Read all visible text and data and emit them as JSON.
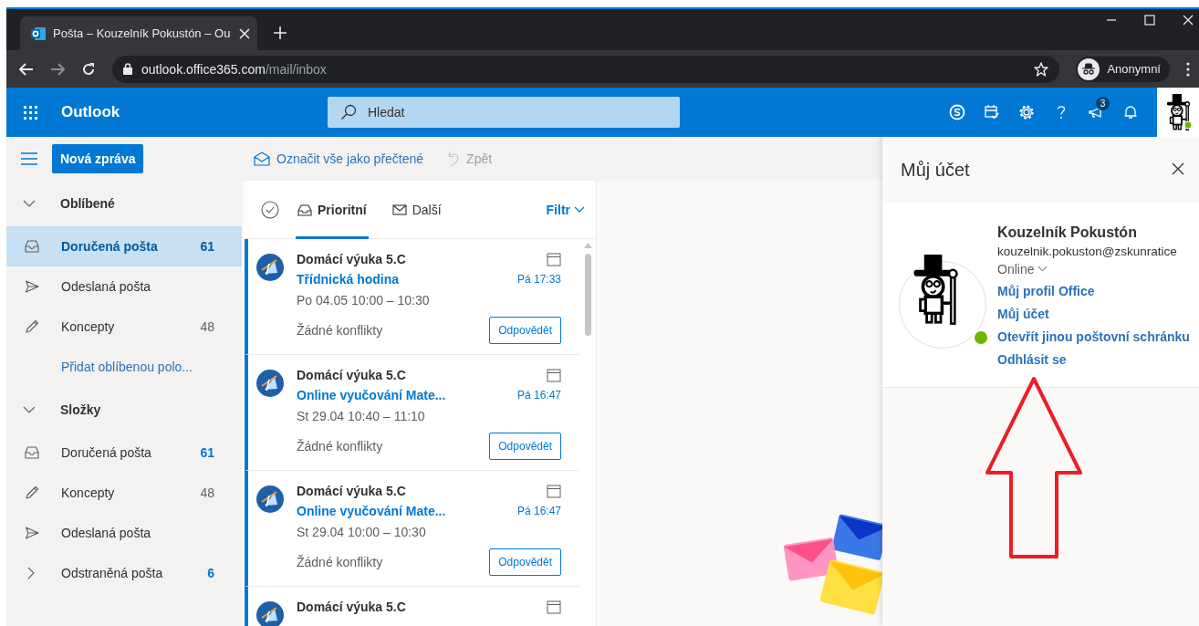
{
  "browser": {
    "tab_title": "Pošta – Kouzelník Pokustón – Ou",
    "url_host": "outlook.office365.com",
    "url_path": "/mail/inbox",
    "profile": "Anonymní"
  },
  "header": {
    "app_name": "Outlook",
    "search": {
      "placeholder": "Hledat"
    },
    "notification_badge": "3"
  },
  "commands": {
    "new_message": "Nová zpráva",
    "mark_all_read": "Označit vše jako přečtené",
    "undo": {
      "label": "Zpět",
      "disabled": true
    }
  },
  "nav": {
    "sections": [
      {
        "title": "Oblíbené",
        "expanded": true,
        "items": [
          {
            "kind": "inbox",
            "label": "Doručená pošta",
            "count": "61",
            "unread": true,
            "selected": true,
            "has_subfolders": false
          },
          {
            "kind": "sent",
            "label": "Odeslaná pošta",
            "selected": false,
            "has_subfolders": false
          },
          {
            "kind": "drafts",
            "label": "Koncepty",
            "count": "48",
            "unread": false,
            "selected": false,
            "has_subfolders": false
          },
          {
            "kind": "link",
            "label": "Přidat oblíbenou polo...",
            "selected": false
          }
        ]
      },
      {
        "title": "Složky",
        "expanded": true,
        "items": [
          {
            "kind": "inbox",
            "label": "Doručená pošta",
            "count": "61",
            "unread": true,
            "selected": false,
            "has_subfolders": false
          },
          {
            "kind": "drafts",
            "label": "Koncepty",
            "count": "48",
            "unread": false,
            "selected": false,
            "has_subfolders": false
          },
          {
            "kind": "sent",
            "label": "Odeslaná pošta",
            "selected": false,
            "has_subfolders": false
          },
          {
            "kind": "deleted",
            "label": "Odstraněná pošta",
            "count": "6",
            "unread": true,
            "selected": false,
            "has_subfolders": true
          }
        ]
      }
    ]
  },
  "mail_list": {
    "tabs": [
      {
        "label": "Prioritní",
        "selected": true
      },
      {
        "label": "Další",
        "selected": false
      }
    ],
    "filter": "Filtr",
    "messages": [
      {
        "sender": "Domácí výuka 5.C",
        "subject": "Třídnická hodina",
        "time": "Pá 17:33",
        "when": "Po 04.05 10:00 – 10:30",
        "status": "Žádné konflikty",
        "action": "Odpovědět",
        "unread": true
      },
      {
        "sender": "Domácí výuka 5.C",
        "subject": "Online vyučování Mate...",
        "time": "Pá 16:47",
        "when": "St 29.04 10:40 – 11:10",
        "status": "Žádné konflikty",
        "action": "Odpovědět",
        "unread": true
      },
      {
        "sender": "Domácí výuka 5.C",
        "subject": "Online vyučování Mate...",
        "time": "Pá 16:47",
        "when": "St 29.04 10:00 – 10:30",
        "status": "Žádné konflikty",
        "action": "Odpovědět",
        "unread": true
      },
      {
        "sender": "Domácí výuka 5.C",
        "unread": true
      }
    ]
  },
  "account_panel": {
    "title": "Můj účet",
    "name": "Kouzelník Pokustón",
    "email": "kouzelnik.pokuston@zskunratice",
    "presence": "Online",
    "online": true,
    "links": [
      "Můj profil Office",
      "Můj účet",
      "Otevřít jinou poštovní schránku",
      "Odhlásit se"
    ]
  }
}
